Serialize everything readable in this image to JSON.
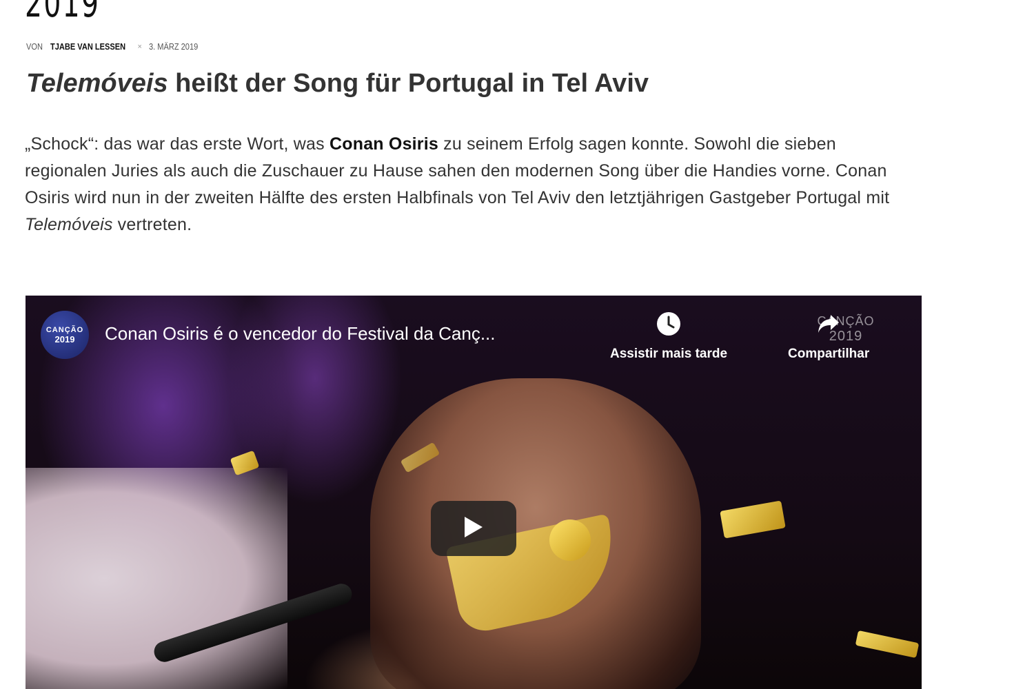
{
  "article": {
    "title_fragment": "2019",
    "byline": {
      "prefix": "VON",
      "author": "TJABE VAN LESSEN",
      "separator": "×",
      "date": "3. MÄRZ 2019"
    },
    "subtitle": {
      "italic": "Telemóveis",
      "rest": " heißt der Song für Portugal in Tel Aviv"
    },
    "paragraph": {
      "part1": "„Schock“: das war das erste Wort, was ",
      "bold": "Conan Osiris",
      "part2": " zu seinem Erfolg sagen konnte. Sowohl die sieben regionalen Juries als auch die Zuschauer zu Hause sahen den modernen Song über die Handies vorne. Conan Osiris wird nun in der zweiten Hälfte des ersten Halbfinals von Tel Aviv den letztjährigen Gastgeber Portugal mit ",
      "italic": "Telemóveis",
      "part3": " vertreten."
    }
  },
  "video": {
    "channel_logo": {
      "line1": "CANÇÃO",
      "line2": "2019"
    },
    "title": "Conan Osiris é o vencedor do Festival da Canç...",
    "watch_later_label": "Assistir mais tarde",
    "share_label": "Compartilhar",
    "watermark": {
      "line1": "CANÇÃO",
      "line2": "2019"
    },
    "icons": {
      "watch_later": "clock-icon",
      "share": "share-arrow-icon",
      "play": "play-icon"
    },
    "colors": {
      "play_button_bg": "#212121",
      "logo_bg": "#1c2466"
    }
  }
}
